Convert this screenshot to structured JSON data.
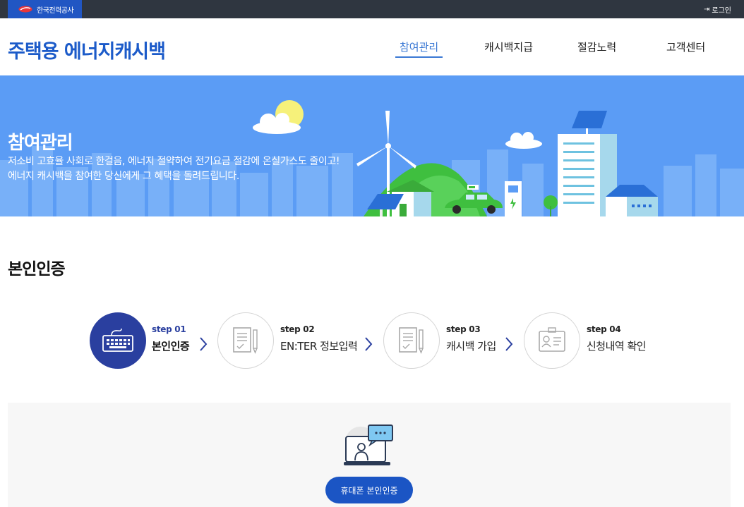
{
  "topbar": {
    "brand_label": "한국전력공사",
    "login_label": "로그인",
    "login_icon": "login-icon"
  },
  "header": {
    "site_title": "주택용 에너지캐시백",
    "nav": [
      {
        "label": "참여관리",
        "active": true
      },
      {
        "label": "캐시백지급",
        "active": false
      },
      {
        "label": "절감노력",
        "active": false
      },
      {
        "label": "고객센터",
        "active": false
      }
    ]
  },
  "hero": {
    "title": "참여관리",
    "line1": "저소비 고효율 사회로 한걸음, 에너지 절약하여 전기요금 절감에 온실가스도 줄이고!",
    "line2": "에너지 캐시백을 참여한 당신에게 그 혜택을 돌려드립니다.",
    "background_color": "#5b9cf5"
  },
  "page": {
    "title": "본인인증"
  },
  "steps": [
    {
      "num": "step 01",
      "label": "본인인증",
      "icon": "keyboard-icon",
      "active": true
    },
    {
      "num": "step 02",
      "label": "EN:TER 정보입력",
      "icon": "document-pencil-icon",
      "active": false
    },
    {
      "num": "step 03",
      "label": "캐시백 가입",
      "icon": "document-pencil-icon",
      "active": false
    },
    {
      "num": "step 04",
      "label": "신청내역 확인",
      "icon": "id-card-icon",
      "active": false
    }
  ],
  "auth": {
    "icon": "video-call-icon",
    "button_label": "휴대폰 본인인증"
  },
  "colors": {
    "brand_blue": "#1c5bc9",
    "active_step": "#2a3f9f",
    "topbar": "#2f3640",
    "button": "#1b55c4"
  }
}
